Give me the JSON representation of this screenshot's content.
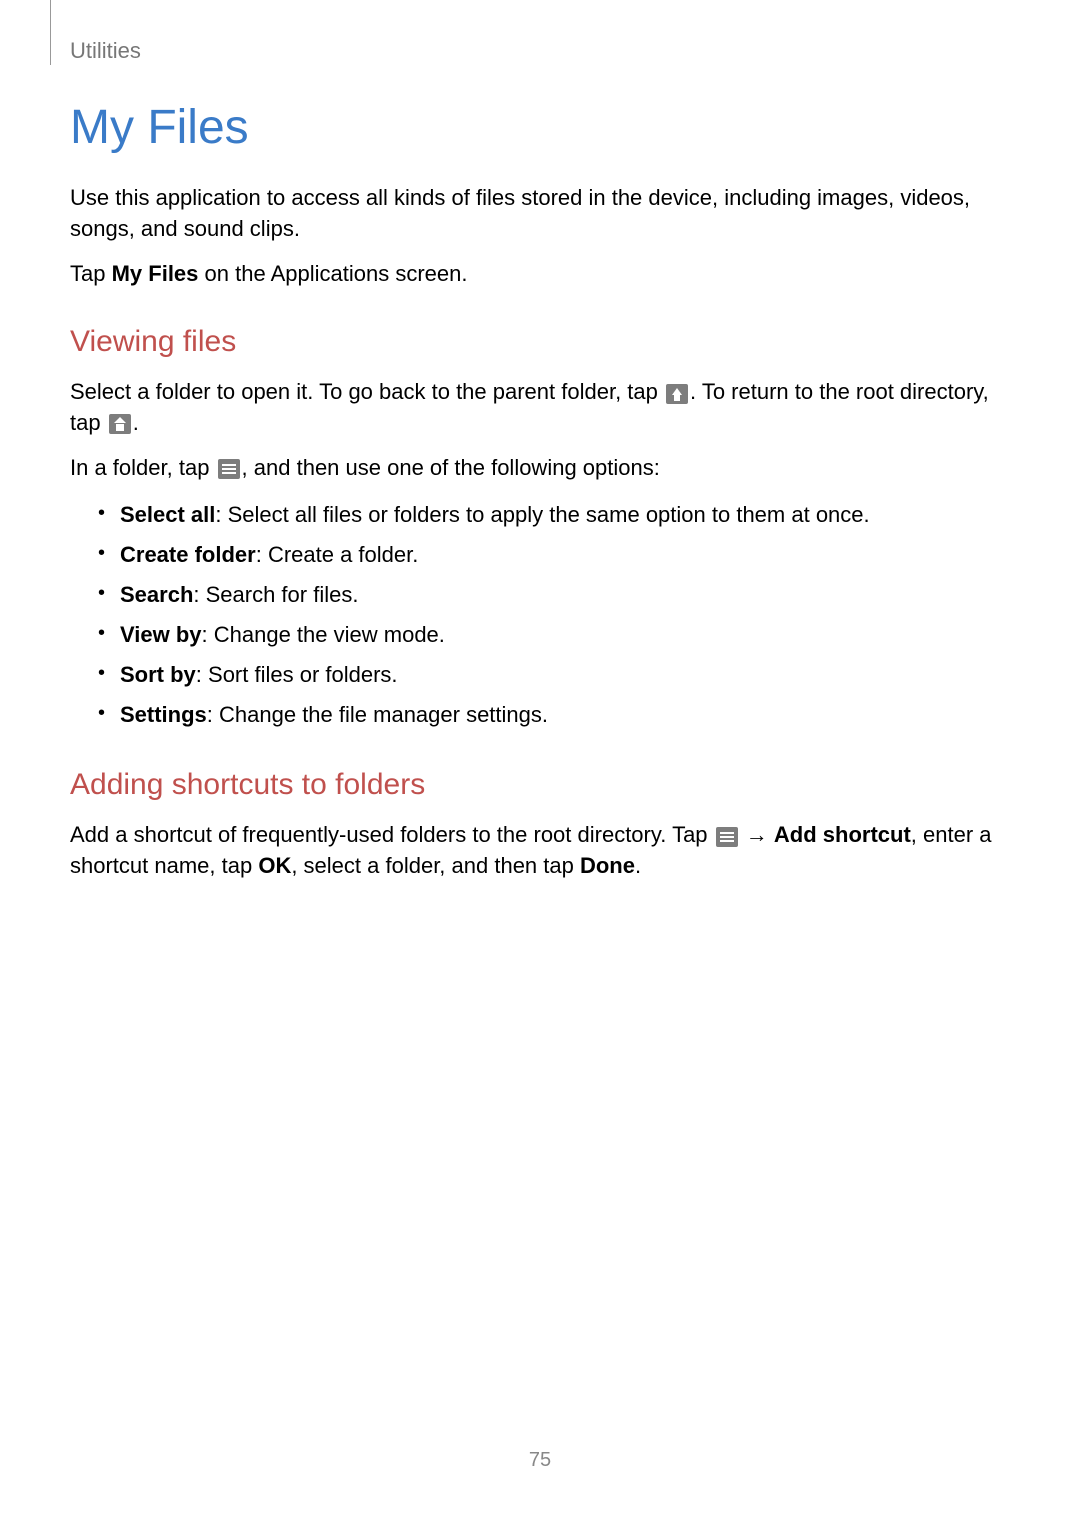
{
  "header": {
    "section_label": "Utilities"
  },
  "title": "My Files",
  "intro_p1": "Use this application to access all kinds of files stored in the device, including images, videos, songs, and sound clips.",
  "intro_p2_a": "Tap ",
  "intro_p2_b": "My Files",
  "intro_p2_c": " on the Applications screen.",
  "section_viewing": {
    "heading": "Viewing files",
    "p1_a": "Select a folder to open it. To go back to the parent folder, tap ",
    "p1_b": ". To return to the root directory, tap ",
    "p1_c": ".",
    "p2_a": "In a folder, tap ",
    "p2_b": ", and then use one of the following options:",
    "bullets": [
      {
        "label": "Select all",
        "desc": ": Select all files or folders to apply the same option to them at once."
      },
      {
        "label": "Create folder",
        "desc": ": Create a folder."
      },
      {
        "label": "Search",
        "desc": ": Search for files."
      },
      {
        "label": "View by",
        "desc": ": Change the view mode."
      },
      {
        "label": "Sort by",
        "desc": ": Sort files or folders."
      },
      {
        "label": "Settings",
        "desc": ": Change the file manager settings."
      }
    ]
  },
  "section_shortcuts": {
    "heading": "Adding shortcuts to folders",
    "p_a": "Add a shortcut of frequently-used folders to the root directory. Tap ",
    "p_arrow": " → ",
    "p_b": "Add shortcut",
    "p_c": ", enter a shortcut name, tap ",
    "p_d": "OK",
    "p_e": ", select a folder, and then tap ",
    "p_f": "Done",
    "p_g": "."
  },
  "page_number": "75"
}
